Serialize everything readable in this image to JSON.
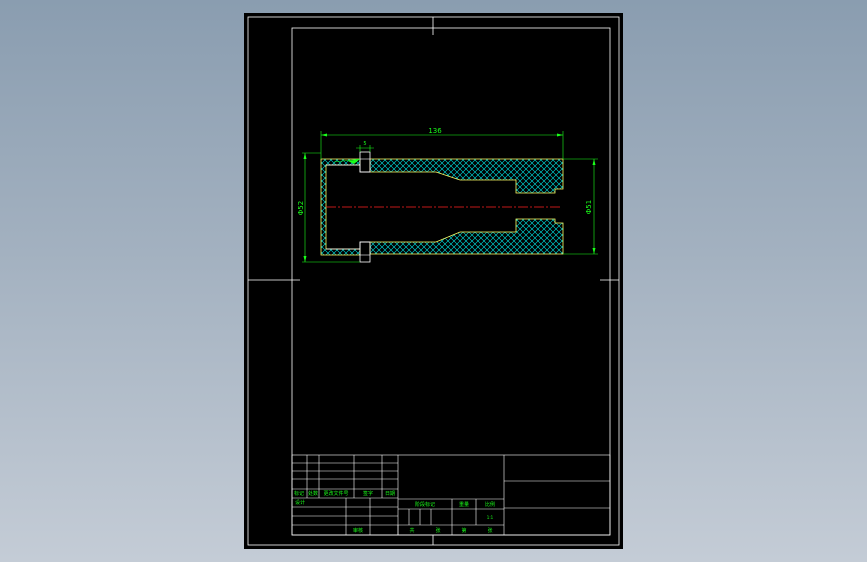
{
  "drawing": {
    "dims": {
      "overall_length": "136",
      "small_step": "5",
      "left_diameter": "Φ52",
      "right_diameter": "Φ51"
    },
    "colors": {
      "background": "#000000",
      "line": "#ffffff",
      "dimension": "#1aff1a",
      "centerline": "#ff2020",
      "hatch": "#00e5e5",
      "outline": "#ffff66"
    }
  },
  "title_block": {
    "left_rows": [
      [
        "标记",
        "处数",
        "更改文件号",
        "签字",
        "日期"
      ],
      [
        "设计",
        "",
        "",
        "",
        ""
      ],
      [
        "",
        "",
        "",
        "",
        ""
      ],
      [
        "",
        "",
        "",
        "审核",
        ""
      ]
    ],
    "middle_header": [
      "阶段标记",
      "重量",
      "比例"
    ],
    "scale": "1:1",
    "middle_footer": [
      "共",
      "张",
      "第",
      "张"
    ]
  }
}
